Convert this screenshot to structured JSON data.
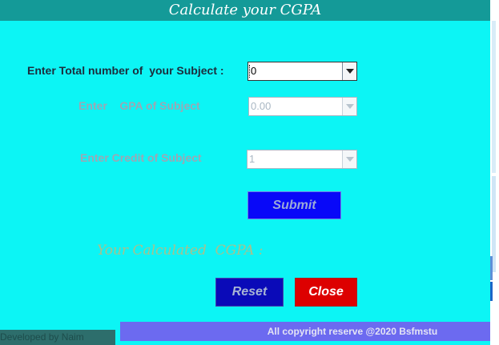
{
  "window": {
    "title": "Calculate your CGPA"
  },
  "form": {
    "subjects": {
      "label": "Enter Total number of  your Subject :",
      "value": "0",
      "enabled": true
    },
    "gpa": {
      "label": "Enter    GPA of Subject",
      "value": "0.00",
      "enabled": false
    },
    "credit": {
      "label": "Enter Credit of Subject",
      "value": "1",
      "enabled": false
    },
    "submit_label": "Submit"
  },
  "result": {
    "label": "Your Calculated  CGPA :"
  },
  "actions": {
    "reset_label": "Reset",
    "close_label": "Close"
  },
  "footer": {
    "developer": "Developed by Naim",
    "copyright": "All copyright reserve @2020 Bsfmstu"
  },
  "colors": {
    "background": "#0cf5f5",
    "title_bar": "#149a98",
    "submit": "#0808f8",
    "reset": "#0a0ab8",
    "close": "#dd0000",
    "copyright_bar": "#6c6af0"
  },
  "icons": {
    "dropdown": "chevron-down-icon"
  }
}
